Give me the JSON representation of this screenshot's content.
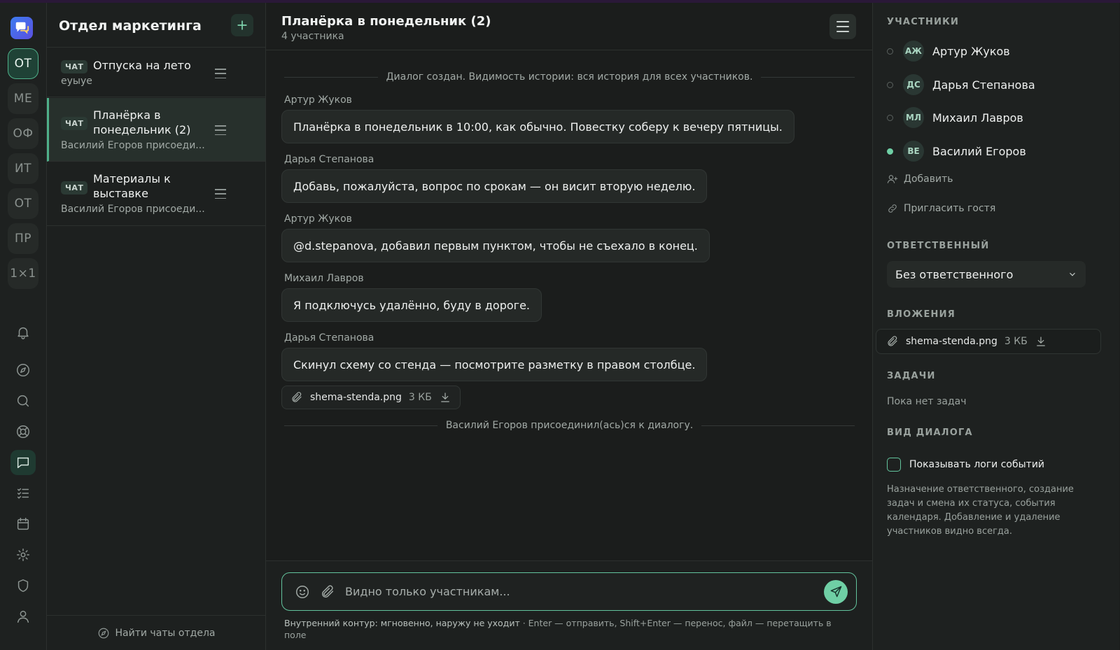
{
  "rail": {
    "spaces": [
      {
        "label": "ОТ",
        "active": true
      },
      {
        "label": "МЕ"
      },
      {
        "label": "ОФ"
      },
      {
        "label": "ИТ"
      },
      {
        "label": "ОТ"
      },
      {
        "label": "ПР"
      },
      {
        "label": "1×1"
      }
    ],
    "icons": [
      "bell-icon",
      "compass-icon",
      "search-icon",
      "lifebuoy-icon",
      "chat-icon",
      "tasks-icon",
      "calendar-icon",
      "gear-icon",
      "shield-icon",
      "user-icon"
    ]
  },
  "chat_list": {
    "title": "Отдел маркетинга",
    "find_label": "Найти чаты отдела",
    "items": [
      {
        "badge": "ЧАТ",
        "name": "Отпуска на лето",
        "subtitle": "еуыуе"
      },
      {
        "badge": "ЧАТ",
        "name": "Планёрка в понедельник (2)",
        "subtitle": "Василий Егоров присоеди...",
        "active": true
      },
      {
        "badge": "ЧАТ",
        "name": "Материалы к выставке",
        "subtitle": "Василий Егоров присоеди..."
      }
    ]
  },
  "dialog": {
    "title": "Планёрка в понедельник (2)",
    "members_count": "4 участника",
    "system_created": "Диалог создан. Видимость истории: вся история для всех участников.",
    "messages": [
      {
        "author": "Артур Жуков",
        "text": "Планёрка в понедельник в 10:00, как обычно. Повестку соберу к вечеру пятницы."
      },
      {
        "author": "Дарья Степанова",
        "text": "Добавь, пожалуйста, вопрос по срокам — он висит вторую неделю."
      },
      {
        "author": "Артур Жуков",
        "text": "@d.stepanova, добавил первым пунктом, чтобы не съехало в конец."
      },
      {
        "author": "Михаил Лавров",
        "text": "Я подключусь удалённо, буду в дороге."
      },
      {
        "author": "Дарья Степанова",
        "text": "Скинул схему со стенда — посмотрите разметку в правом столбце."
      }
    ],
    "attachment": {
      "name": "shema-stenda.png",
      "size": "3 КБ"
    },
    "system_joined": "Василий Егоров присоединил(ась)ся к диалогу."
  },
  "composer": {
    "placeholder": "Видно только участникам...",
    "hint_main": "Внутренний контур: мгновенно, наружу не уходит",
    "hint_rest": " · Enter — отправить, Shift+Enter — перенос, файл — перетащить в поле"
  },
  "side": {
    "participants_title": "УЧАСТНИКИ",
    "participants": [
      {
        "initials": "АЖ",
        "name": "Артур Жуков",
        "online": false
      },
      {
        "initials": "ДС",
        "name": "Дарья Степанова",
        "online": false
      },
      {
        "initials": "МЛ",
        "name": "Михаил Лавров",
        "online": false
      },
      {
        "initials": "ВЕ",
        "name": "Василий Егоров",
        "online": true
      }
    ],
    "add_label": "Добавить",
    "invite_label": "Пригласить гостя",
    "responsible_title": "ОТВЕТСТВЕННЫЙ",
    "responsible_value": "Без ответственного",
    "attachments_title": "ВЛОЖЕНИЯ",
    "attachment": {
      "name": "shema-stenda.png",
      "size": "3 КБ"
    },
    "tasks_title": "ЗАДАЧИ",
    "tasks_empty": "Пока нет задач",
    "view_title": "ВИД ДИАЛОГА",
    "show_logs_label": "Показывать логи событий",
    "show_logs_checked": false,
    "note": "Назначение ответственного, создание задач и смена их статуса, события календаря. Добавление и удаление участников видно всегда."
  },
  "colors": {
    "accent": "#6fcfa5",
    "online": "#6fcfa5",
    "background": "#1b1d1c"
  }
}
